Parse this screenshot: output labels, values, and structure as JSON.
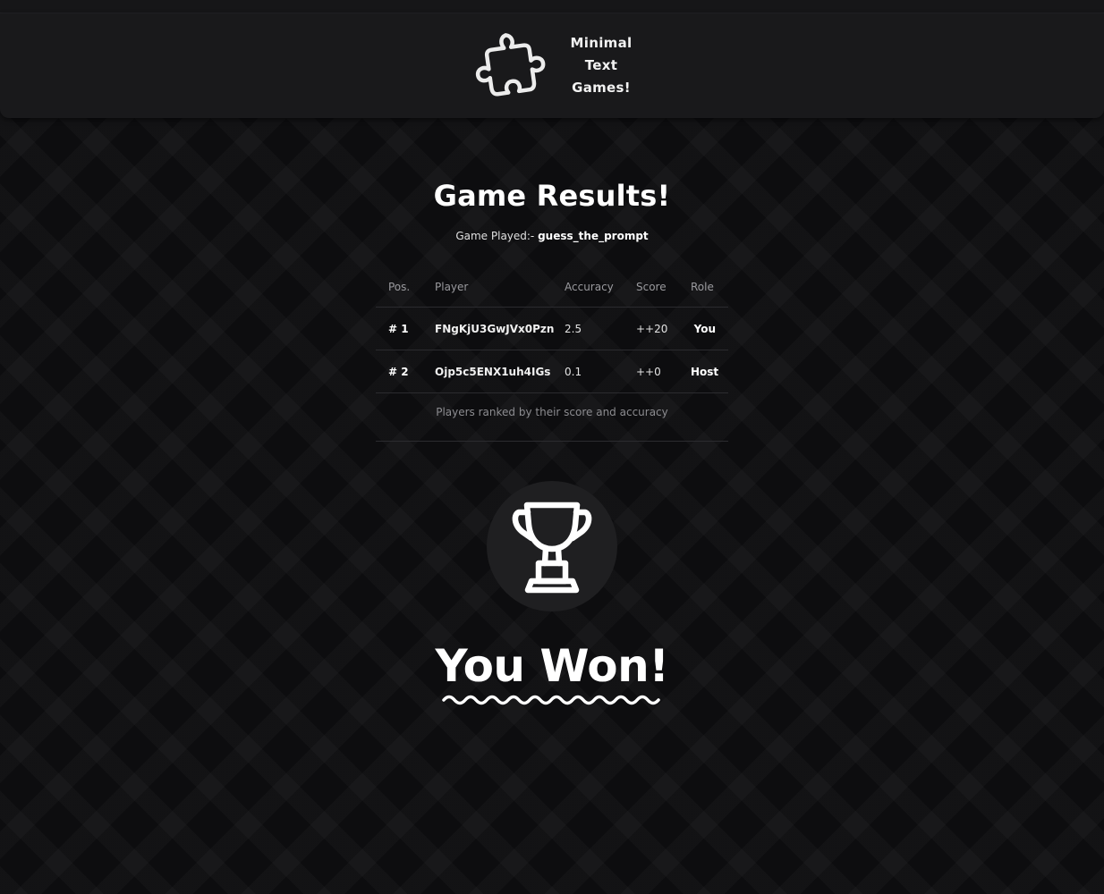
{
  "header": {
    "logo_icon": "puzzle-piece-icon",
    "logo_lines": [
      "Minimal",
      "Text",
      "Games!"
    ]
  },
  "results": {
    "title": "Game Results!",
    "game_played_label": "Game Played:-",
    "game_played_value": "guess_the_prompt",
    "columns": [
      "Pos.",
      "Player",
      "Accuracy",
      "Score",
      "Role"
    ],
    "rows": [
      {
        "pos": "# 1",
        "player": "FNgKjU3GwJVx0Pzn",
        "accuracy": "2.5",
        "score": "++20",
        "role": "You"
      },
      {
        "pos": "# 2",
        "player": "Ojp5c5ENX1uh4IGs",
        "accuracy": "0.1",
        "score": "++0",
        "role": "Host"
      }
    ],
    "caption": "Players ranked by their score and accuracy"
  },
  "outcome": {
    "icon": "trophy-icon",
    "text": "You Won!",
    "underline_icon": "wavy-underline-icon"
  },
  "colors": {
    "background": "#0d0d0f",
    "header_bg": "#19191b",
    "text": "#ffffff",
    "muted": "#9a9a9e",
    "trophy_circle": "#1f1f21"
  }
}
